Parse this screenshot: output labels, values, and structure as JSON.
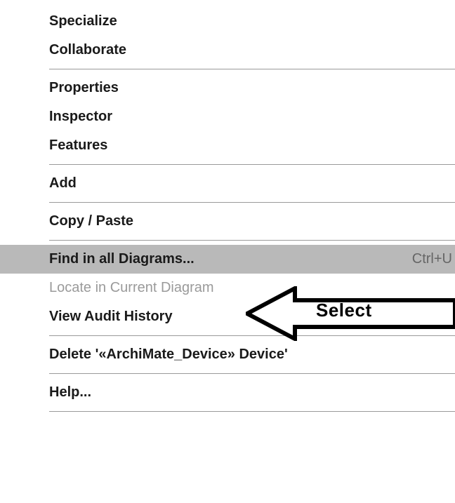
{
  "menu": {
    "items": [
      {
        "label": "Specialize",
        "disabled": false,
        "highlighted": false,
        "shortcut": "",
        "sep_after": false
      },
      {
        "label": "Collaborate",
        "disabled": false,
        "highlighted": false,
        "shortcut": "",
        "sep_after": true
      },
      {
        "label": "Properties",
        "disabled": false,
        "highlighted": false,
        "shortcut": "",
        "sep_after": false
      },
      {
        "label": "Inspector",
        "disabled": false,
        "highlighted": false,
        "shortcut": "",
        "sep_after": false
      },
      {
        "label": "Features",
        "disabled": false,
        "highlighted": false,
        "shortcut": "",
        "sep_after": true
      },
      {
        "label": "Add",
        "disabled": false,
        "highlighted": false,
        "shortcut": "",
        "sep_after": true
      },
      {
        "label": "Copy / Paste",
        "disabled": false,
        "highlighted": false,
        "shortcut": "",
        "sep_after": true
      },
      {
        "label": "Find in all Diagrams...",
        "disabled": false,
        "highlighted": true,
        "shortcut": "Ctrl+U",
        "sep_after": false
      },
      {
        "label": "Locate in Current Diagram",
        "disabled": true,
        "highlighted": false,
        "shortcut": "",
        "sep_after": false
      },
      {
        "label": "View Audit History",
        "disabled": false,
        "highlighted": false,
        "shortcut": "",
        "sep_after": true
      },
      {
        "label": "Delete '«ArchiMate_Device» Device'",
        "disabled": false,
        "highlighted": false,
        "shortcut": "",
        "sep_after": true
      },
      {
        "label": "Help...",
        "disabled": false,
        "highlighted": false,
        "shortcut": "",
        "sep_after": true
      }
    ]
  },
  "annotation": {
    "label": "Select"
  }
}
